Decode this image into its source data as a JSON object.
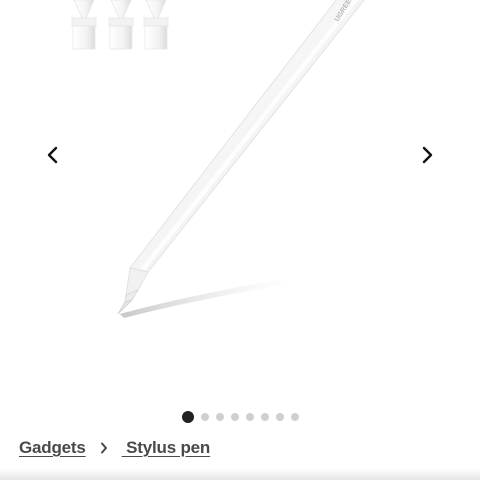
{
  "product": {
    "image_alt": "Stylus pen",
    "engraving": "UGREEN"
  },
  "carousel": {
    "prev_icon": "chevron-left-icon",
    "next_icon": "chevron-right-icon",
    "slide_count": 8,
    "active_slide": 1
  },
  "breadcrumb": {
    "items": [
      {
        "label": "Gadgets"
      },
      {
        "label": " Stylus pen"
      }
    ],
    "separator_icon": "chevron-right-icon"
  },
  "colors": {
    "text": "#4a4a4a",
    "dot_active": "#222222",
    "dot_inactive": "#cfcfcf"
  }
}
